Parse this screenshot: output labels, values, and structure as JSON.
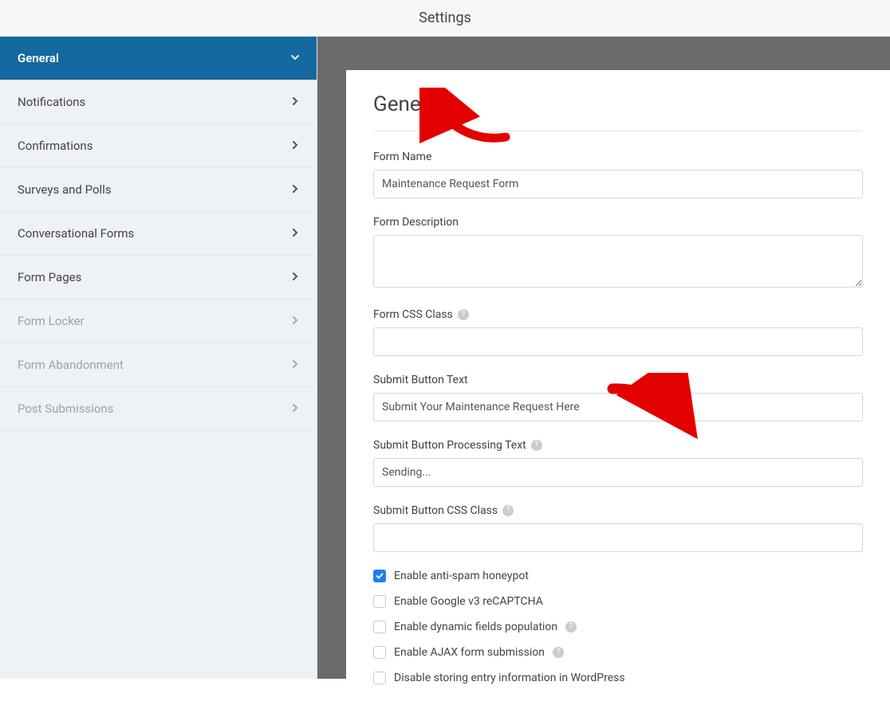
{
  "topbar": {
    "title": "Settings"
  },
  "sidebar": {
    "items": [
      {
        "label": "General",
        "active": true,
        "disabled": false
      },
      {
        "label": "Notifications",
        "active": false,
        "disabled": false
      },
      {
        "label": "Confirmations",
        "active": false,
        "disabled": false
      },
      {
        "label": "Surveys and Polls",
        "active": false,
        "disabled": false
      },
      {
        "label": "Conversational Forms",
        "active": false,
        "disabled": false
      },
      {
        "label": "Form Pages",
        "active": false,
        "disabled": false
      },
      {
        "label": "Form Locker",
        "active": false,
        "disabled": true
      },
      {
        "label": "Form Abandonment",
        "active": false,
        "disabled": true
      },
      {
        "label": "Post Submissions",
        "active": false,
        "disabled": true
      }
    ]
  },
  "panel": {
    "heading": "General",
    "fields": {
      "form_name": {
        "label": "Form Name",
        "value": "Maintenance Request Form"
      },
      "form_description": {
        "label": "Form Description",
        "value": ""
      },
      "form_css_class": {
        "label": "Form CSS Class",
        "value": "",
        "help": true
      },
      "submit_button_text": {
        "label": "Submit Button Text",
        "value": "Submit Your Maintenance Request Here"
      },
      "submit_button_processing": {
        "label": "Submit Button Processing Text",
        "value": "Sending...",
        "help": true
      },
      "submit_button_css_class": {
        "label": "Submit Button CSS Class",
        "value": "",
        "help": true
      }
    },
    "checkboxes": [
      {
        "label": "Enable anti-spam honeypot",
        "checked": true,
        "help": false
      },
      {
        "label": "Enable Google v3 reCAPTCHA",
        "checked": false,
        "help": false
      },
      {
        "label": "Enable dynamic fields population",
        "checked": false,
        "help": true
      },
      {
        "label": "Enable AJAX form submission",
        "checked": false,
        "help": true
      },
      {
        "label": "Disable storing entry information in WordPress",
        "checked": false,
        "help": false
      }
    ]
  }
}
